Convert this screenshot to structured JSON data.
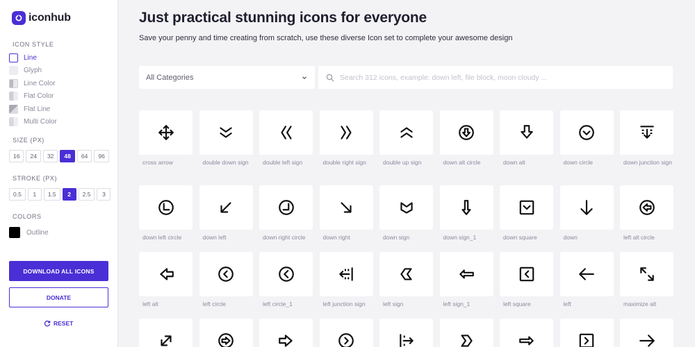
{
  "brand": {
    "name": "iconhub",
    "accent": "#4a2fd6"
  },
  "sidebar": {
    "icon_style_title": "ICON STYLE",
    "styles": [
      {
        "label": "Line",
        "swatch": "line",
        "active": true
      },
      {
        "label": "Glyph",
        "swatch": "glyph",
        "active": false
      },
      {
        "label": "Line Color",
        "swatch": "linecolor",
        "active": false
      },
      {
        "label": "Flat Color",
        "swatch": "flat",
        "active": false
      },
      {
        "label": "Flat Line",
        "swatch": "flatline",
        "active": false
      },
      {
        "label": "Multi Color",
        "swatch": "multi",
        "active": false
      }
    ],
    "size_title": "SIZE (PX)",
    "sizes": [
      "16",
      "24",
      "32",
      "48",
      "64",
      "96"
    ],
    "size_selected": "48",
    "stroke_title": "STROKE (PX)",
    "strokes": [
      "0.5",
      "1",
      "1.5",
      "2",
      "2.5",
      "3"
    ],
    "stroke_selected": "2",
    "colors_title": "COLORS",
    "color_label": "Outline",
    "color_value": "#000000",
    "download_label": "DOWNLOAD ALL ICONS",
    "donate_label": "DONATE",
    "reset_label": "RESET"
  },
  "main": {
    "headline": "Just practical stunning icons for everyone",
    "subline": "Save your penny and time creating from scratch, use these diverse Icon set to complete your awesome design",
    "category_label": "All Categories",
    "search_placeholder": "Search 312 icons, example: down left, file block, moon cloudy ..."
  },
  "icons": [
    {
      "name": "cross arrow",
      "icon": "cross-arrow-icon"
    },
    {
      "name": "double down sign",
      "icon": "double-down-sign-icon"
    },
    {
      "name": "double left sign",
      "icon": "double-left-sign-icon"
    },
    {
      "name": "double right sign",
      "icon": "double-right-sign-icon"
    },
    {
      "name": "double up sign",
      "icon": "double-up-sign-icon"
    },
    {
      "name": "down alt circle",
      "icon": "down-alt-circle-icon"
    },
    {
      "name": "down alt",
      "icon": "down-alt-icon"
    },
    {
      "name": "down circle",
      "icon": "down-circle-icon"
    },
    {
      "name": "down junction sign",
      "icon": "down-junction-sign-icon"
    },
    {
      "name": "down left circle",
      "icon": "down-left-circle-icon"
    },
    {
      "name": "down left",
      "icon": "down-left-icon"
    },
    {
      "name": "down right circle",
      "icon": "down-right-circle-icon"
    },
    {
      "name": "down right",
      "icon": "down-right-icon"
    },
    {
      "name": "down sign",
      "icon": "down-sign-icon"
    },
    {
      "name": "down sign_1",
      "icon": "down-sign-1-icon"
    },
    {
      "name": "down square",
      "icon": "down-square-icon"
    },
    {
      "name": "down",
      "icon": "down-icon"
    },
    {
      "name": "left alt circle",
      "icon": "left-alt-circle-icon"
    },
    {
      "name": "left alt",
      "icon": "left-alt-icon"
    },
    {
      "name": "left circle",
      "icon": "left-circle-icon"
    },
    {
      "name": "left circle_1",
      "icon": "left-circle-1-icon"
    },
    {
      "name": "left junction sign",
      "icon": "left-junction-sign-icon"
    },
    {
      "name": "left sign",
      "icon": "left-sign-icon"
    },
    {
      "name": "left sign_1",
      "icon": "left-sign-1-icon"
    },
    {
      "name": "left square",
      "icon": "left-square-icon"
    },
    {
      "name": "left",
      "icon": "left-icon"
    },
    {
      "name": "maximize alt",
      "icon": "maximize-alt-icon"
    },
    {
      "name": "",
      "icon": "maximize-icon"
    },
    {
      "name": "",
      "icon": "right-alt-circle-icon"
    },
    {
      "name": "",
      "icon": "right-alt-icon"
    },
    {
      "name": "",
      "icon": "right-circle-icon"
    },
    {
      "name": "",
      "icon": "right-junction-sign-icon"
    },
    {
      "name": "",
      "icon": "right-sign-icon"
    },
    {
      "name": "",
      "icon": "right-alt-2-icon"
    },
    {
      "name": "",
      "icon": "right-square-icon"
    },
    {
      "name": "",
      "icon": "right-icon"
    }
  ]
}
